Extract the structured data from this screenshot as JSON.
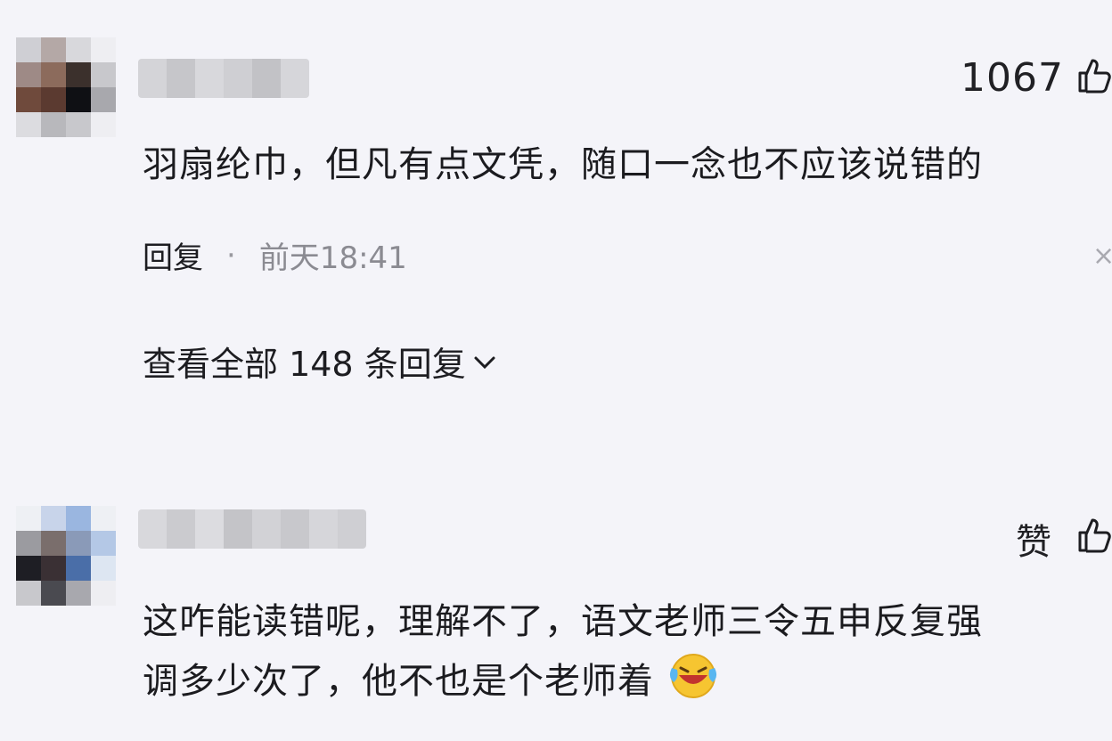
{
  "comments": [
    {
      "like_count": "1067",
      "text": "羽扇纶巾，但凡有点文凭，随口一念也不应该说错的",
      "reply_label": "回复",
      "separator": "·",
      "time": "前天18:41",
      "close_glyph": "×",
      "view_replies_label": "查看全部 148 条回复",
      "view_replies_chevron": "⌄",
      "avatar_colors": [
        "#cfcfd4",
        "#b4a8a6",
        "#d8d8dc",
        "#eeeef2",
        "#9e8a86",
        "#8c6b5c",
        "#3b302c",
        "#c8c8cc",
        "#6f4a3c",
        "#5b3a30",
        "#0f1014",
        "#a8a8ad",
        "#dcdce0",
        "#b8b8bc",
        "#c8c8cc",
        "#eeeef2"
      ],
      "name_colors": [
        "#d4d4d8",
        "#c6c6ca",
        "#d8d8dc",
        "#cfcfd3",
        "#c2c2c6",
        "#d6d6da"
      ]
    },
    {
      "like_label": "赞",
      "text_line1": "这咋能读错呢，理解不了，语文老师三令五申反复强",
      "text_line2": "调多少次了，他不也是个老师着",
      "emoji": "laughing-crying-emoji",
      "avatar_colors": [
        "#eef0f4",
        "#c8d4ea",
        "#9ab6e0",
        "#eef0f4",
        "#9b9ba0",
        "#7a6e6c",
        "#8a9ab8",
        "#b4c8e6",
        "#1e1e24",
        "#3a3034",
        "#4a6ea8",
        "#dde6f2",
        "#c8c8cc",
        "#4a4a50",
        "#a8a8ae",
        "#eeeef2"
      ],
      "name_colors": [
        "#d8d8dc",
        "#cbcbcf",
        "#dcdce0",
        "#c4c4c8",
        "#d2d2d6",
        "#c8c8cc",
        "#d6d6da",
        "#cfcfd3"
      ]
    }
  ],
  "colors": {
    "background": "#f4f4f9",
    "text": "#1b1b1f",
    "muted": "#8b8b92"
  }
}
